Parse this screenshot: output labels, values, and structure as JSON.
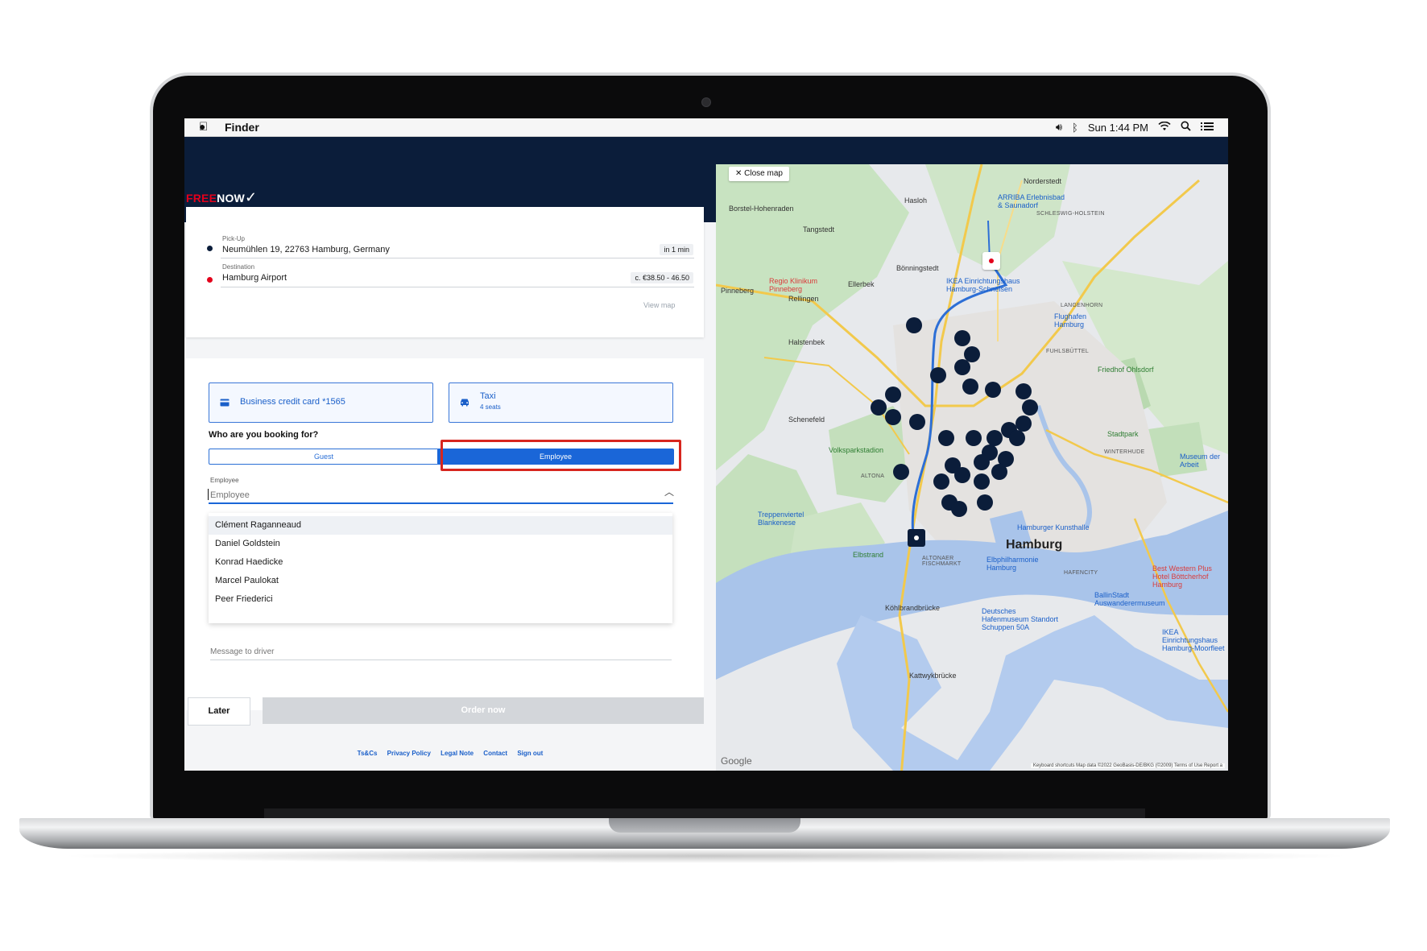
{
  "menubar": {
    "app_name": "Finder",
    "clock": "Sun 1:44 PM",
    "icons": [
      "apple-icon",
      "volume-icon",
      "bluetooth-icon",
      "wifi-icon",
      "search-icon",
      "list-icon"
    ]
  },
  "brand": {
    "free": "FREE",
    "now": "NOW"
  },
  "trip": {
    "pickup_label": "Pick-Up",
    "pickup_address": "Neumühlen 19, 22763 Hamburg, Germany",
    "pickup_eta": "in 1 min",
    "destination_label": "Destination",
    "destination_address": "Hamburg Airport",
    "price": "c. €38.50 - 46.50",
    "view_map": "View map"
  },
  "options": {
    "payment": "Business credit card *1565",
    "vehicle": "Taxi",
    "vehicle_seats": "4 seats"
  },
  "booking": {
    "question": "Who are you booking for?",
    "guest": "Guest",
    "employee": "Employee",
    "employee_field_label": "Employee",
    "employee_field_placeholder": "Employee",
    "employees": [
      "Clément Raganneaud",
      "Daniel Goldstein",
      "Konrad Haedicke",
      "Marcel Paulokat",
      "Peer Friederici"
    ],
    "message_placeholder": "Message to driver"
  },
  "actions": {
    "later": "Later",
    "order": "Order now"
  },
  "footer": [
    "Ts&Cs",
    "Privacy Policy",
    "Legal Note",
    "Contact",
    "Sign out"
  ],
  "map": {
    "close": "Close map",
    "city": "Hamburg",
    "labels": {
      "norderstedt": "Norderstedt",
      "hasloh": "Hasloh",
      "tangstedt": "Tangstedt",
      "schleswig_holstein": "SCHLESWIG-HOLSTEIN",
      "borstel": "Borstel-Hohenraden",
      "pinneberg": "Pinneberg",
      "rellingen": "Rellingen",
      "ellerbek": "Ellerbek",
      "boenningstedt": "Bönningstedt",
      "halstenbek": "Halstenbek",
      "schenefeld": "Schenefeld",
      "langenhorn": "LANGENHORN",
      "fuhlsbuettel": "FUHLSBÜTTEL",
      "flughafen": "Flughafen Hamburg",
      "ohlsdorf": "Friedhof Ohlsdorf",
      "winterhude": "WINTERHUDE",
      "stadtpark": "Stadtpark",
      "volkspark": "Volksparkstadion",
      "elbphilharmonie": "Elbphilharmonie Hamburg",
      "altona": "ALTONA",
      "fischmarkt": "ALTONAER FISCHMARKT",
      "hafencity": "HAFENCITY",
      "arriba": "ARRIBA Erlebnisbad & Saunadorf",
      "ikea": "IKEA Einrichtungshaus Hamburg-Schnelsen",
      "regio": "Regio Klinikum Pinneberg",
      "museum": "Museum der Arbeit",
      "ballinstadt": "BallinStadt Auswanderermuseum",
      "kunsthalle": "Hamburger Kunsthalle",
      "bestwestern": "Best Western Plus Hotel Böttcherhof Hamburg",
      "koehlbrand": "Köhlbrandbrücke",
      "kattwyk": "Kattwykbrücke",
      "treppenviertel": "Treppenviertel Blankenese",
      "elbstrand": "Elbstrand",
      "ikea_moorfleet": "IKEA Einrichtungshaus Hamburg-Moorfleet",
      "hafenmuseum": "Deutsches Hafenmuseum Standort Schuppen 50A"
    },
    "google": "Google",
    "attribution": "Keyboard shortcuts   Map data ©2022 GeoBasis-DE/BKG (©2009)   Terms of Use   Report a"
  },
  "colors": {
    "navy": "#0b1d3a",
    "brand_red": "#e3001b",
    "accent_blue": "#1a66d8",
    "highlight_red": "#d7261e"
  }
}
